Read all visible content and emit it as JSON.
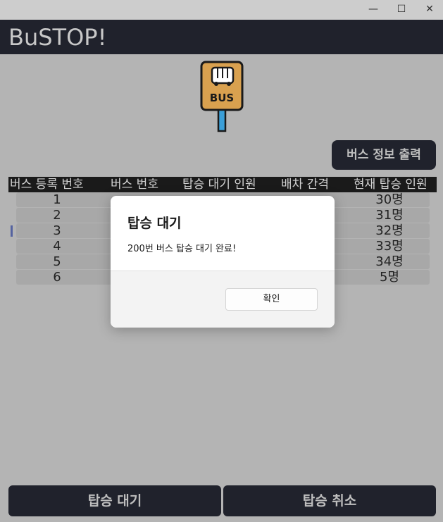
{
  "window": {
    "min_icon": "—",
    "max_icon": "☐",
    "close_icon": "✕"
  },
  "app": {
    "title": "BuSTOP!"
  },
  "logo": {
    "text": "BUS",
    "icon": "bus-stop-icon"
  },
  "print_button": {
    "label": "버스 정보 출력"
  },
  "table": {
    "headers": [
      "버스 등록 번호",
      "버스 번호",
      "탑승 대기 인원",
      "배차 간격",
      "현재 탑승 인원"
    ],
    "rows": [
      {
        "reg": "1",
        "current": "30명"
      },
      {
        "reg": "2",
        "current": "31명"
      },
      {
        "reg": "3",
        "current": "32명"
      },
      {
        "reg": "4",
        "current": "33명"
      },
      {
        "reg": "5",
        "current": "34명"
      },
      {
        "reg": "6",
        "current": "5명"
      }
    ]
  },
  "dialog": {
    "title": "탑승 대기",
    "message": "200번 버스 탑승 대기 완료!",
    "ok_label": "확인"
  },
  "bottom": {
    "board_label": "탑승 대기",
    "cancel_label": "탑승 취소"
  },
  "colors": {
    "header_bg": "#20222c",
    "background": "#b4b4b4",
    "logo_orange": "#d9a14f",
    "logo_blue": "#3b9fd8"
  }
}
